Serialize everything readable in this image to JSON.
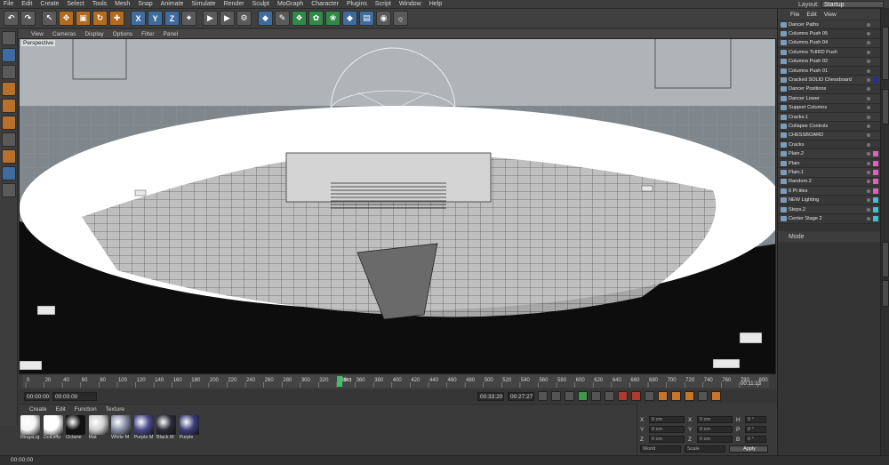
{
  "menubar": {
    "items": [
      "File",
      "Edit",
      "Create",
      "Select",
      "Tools",
      "Mesh",
      "Snap",
      "Animate",
      "Simulate",
      "Render",
      "Sculpt",
      "MoGraph",
      "Character",
      "Plugins",
      "Script",
      "Window",
      "Help"
    ],
    "layout_label": "Layout:",
    "layout_value": "Startup"
  },
  "toolbar": {
    "axis_x": "X",
    "axis_y": "Y",
    "axis_z": "Z"
  },
  "viewport": {
    "menu": [
      "View",
      "Cameras",
      "Display",
      "Options",
      "Filter",
      "Panel"
    ],
    "label": "Perspective"
  },
  "timeline": {
    "ticks": [
      "0",
      "20",
      "40",
      "60",
      "80",
      "100",
      "120",
      "140",
      "160",
      "180",
      "200",
      "220",
      "240",
      "260",
      "280",
      "300",
      "320",
      "340",
      "360",
      "380",
      "400",
      "420",
      "440",
      "460",
      "480",
      "500",
      "520",
      "540",
      "560",
      "580",
      "600",
      "620",
      "640",
      "660",
      "680",
      "700",
      "720",
      "740",
      "760",
      "780",
      "800"
    ],
    "current_frame": "343",
    "end_label": "00:11:13"
  },
  "transport": {
    "start_time": "00:00:00",
    "min_time": "00:00:00",
    "current_time": "00:27:27",
    "max_time": "00:33:20"
  },
  "materials": {
    "menu": [
      "Create",
      "Edit",
      "Function",
      "Texture"
    ],
    "items": [
      {
        "label": "RingsLig",
        "color": "#f4f4f4"
      },
      {
        "label": "OctDiffu",
        "color": "#ffffff"
      },
      {
        "label": "Octane",
        "color": "#111111"
      },
      {
        "label": "Mat",
        "color": "#cfcfcf"
      },
      {
        "label": "White M",
        "color": "#8a8fa8"
      },
      {
        "label": "Purple M",
        "color": "#4a4a8a"
      },
      {
        "label": "Black M",
        "color": "#2b2b3a"
      },
      {
        "label": "Purple",
        "color": "#3d3d7a"
      }
    ]
  },
  "coords": {
    "rows": [
      {
        "axis": "X",
        "pos": "0 cm",
        "size": "0 cm",
        "rot_axis": "H",
        "rot": "0 °"
      },
      {
        "axis": "Y",
        "pos": "0 cm",
        "size": "0 cm",
        "rot_axis": "P",
        "rot": "0 °"
      },
      {
        "axis": "Z",
        "pos": "0 cm",
        "size": "0 cm",
        "rot_axis": "B",
        "rot": "0 °"
      }
    ],
    "mode_world": "World",
    "mode_scale": "Scale",
    "apply": "Apply"
  },
  "status": {
    "text": "00:00:00"
  },
  "objects": {
    "menu": [
      "File",
      "Edit",
      "View"
    ],
    "items": [
      {
        "label": "Dancer Paths",
        "tag": ""
      },
      {
        "label": "Columns Push 05",
        "tag": ""
      },
      {
        "label": "Columns Push 04",
        "tag": ""
      },
      {
        "label": "Columns THIRD Push",
        "tag": ""
      },
      {
        "label": "Columns Push 02",
        "tag": ""
      },
      {
        "label": "Columns Push 01",
        "tag": ""
      },
      {
        "label": "Cracked SOLID Chessboard",
        "tag": "#2a2aa0"
      },
      {
        "label": "Dancer Positions",
        "tag": ""
      },
      {
        "label": "Dancer Lower",
        "tag": ""
      },
      {
        "label": "Support Columns",
        "tag": ""
      },
      {
        "label": "Cracks.1",
        "tag": ""
      },
      {
        "label": "Collapse Controls",
        "tag": ""
      },
      {
        "label": "CHESSBOARD",
        "tag": ""
      },
      {
        "label": "Cracks",
        "tag": ""
      },
      {
        "label": "Plain.2",
        "tag": "#e060c0"
      },
      {
        "label": "Plain",
        "tag": "#e060c0"
      },
      {
        "label": "Plain.1",
        "tag": "#e060c0"
      },
      {
        "label": "Random.2",
        "tag": "#e060c0"
      },
      {
        "label": "6 Pt tiles",
        "tag": "#e060c0"
      },
      {
        "label": "NEW Lighting",
        "tag": "#40c0d0"
      },
      {
        "label": "Steps.2",
        "tag": "#40c0d0"
      },
      {
        "label": "Center Stage 2",
        "tag": "#40c0d0"
      }
    ]
  },
  "attributes": {
    "mode": "Mode"
  }
}
